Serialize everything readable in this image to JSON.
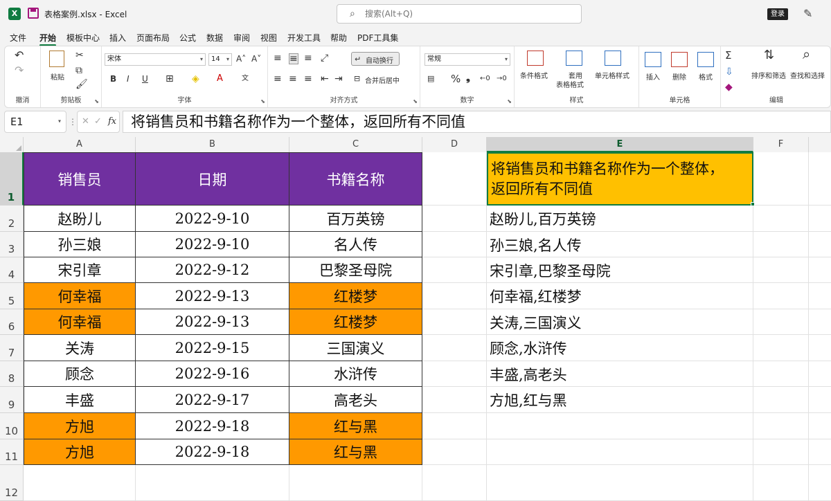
{
  "window": {
    "doc_title": "表格案例.xlsx  -  Excel",
    "search_placeholder": "搜索(Alt+Q)",
    "login_label": "登录",
    "app_logo_letter": "X"
  },
  "menu": {
    "tabs": [
      "文件",
      "开始",
      "模板中心",
      "插入",
      "页面布局",
      "公式",
      "数据",
      "审阅",
      "视图",
      "开发工具",
      "帮助",
      "PDF工具集"
    ],
    "active_index": 1
  },
  "ribbon": {
    "undo_group": "撤消",
    "clipboard_group": "剪贴板",
    "paste_label": "粘贴",
    "font_group": "字体",
    "font_name": "宋体",
    "font_size": "14",
    "bold": "B",
    "italic": "I",
    "underline": "U",
    "align_group": "对齐方式",
    "wrap_text": "自动换行",
    "merge_center": "合并后居中",
    "number_group": "数字",
    "number_format": "常规",
    "percent": "%",
    "comma": "❟",
    "styles_group": "样式",
    "cond_format": "条件格式",
    "table_format_1": "套用",
    "table_format_2": "表格格式",
    "cell_styles": "单元格样式",
    "cells_group": "单元格",
    "insert": "插入",
    "delete": "删除",
    "format": "格式",
    "edit_group": "编辑",
    "sort_filter": "排序和筛选",
    "find_select": "查找和选择"
  },
  "formula_bar": {
    "name_box": "E1",
    "fx": "fx",
    "formula": "将销售员和书籍名称作为一个整体，返回所有不同值"
  },
  "sheet": {
    "columns": [
      "A",
      "B",
      "C",
      "D",
      "E",
      "F"
    ],
    "rows": [
      "1",
      "2",
      "3",
      "4",
      "5",
      "6",
      "7",
      "8",
      "9",
      "10",
      "11",
      "12"
    ],
    "headers": [
      "销售员",
      "日期",
      "书籍名称"
    ],
    "table": [
      {
        "name": "赵盼儿",
        "date": "2022-9-10",
        "book": "百万英镑",
        "dup": false
      },
      {
        "name": "孙三娘",
        "date": "2022-9-10",
        "book": "名人传",
        "dup": false
      },
      {
        "name": "宋引章",
        "date": "2022-9-12",
        "book": "巴黎圣母院",
        "dup": false
      },
      {
        "name": "何幸福",
        "date": "2022-9-13",
        "book": "红楼梦",
        "dup": true
      },
      {
        "name": "何幸福",
        "date": "2022-9-13",
        "book": "红楼梦",
        "dup": true
      },
      {
        "name": "关涛",
        "date": "2022-9-15",
        "book": "三国演义",
        "dup": false
      },
      {
        "name": "顾念",
        "date": "2022-9-16",
        "book": "水浒传",
        "dup": false
      },
      {
        "name": "丰盛",
        "date": "2022-9-17",
        "book": "高老头",
        "dup": false
      },
      {
        "name": "方旭",
        "date": "2022-9-18",
        "book": "红与黑",
        "dup": true
      },
      {
        "name": "方旭",
        "date": "2022-9-18",
        "book": "红与黑",
        "dup": true
      }
    ],
    "e1_line1": "将销售员和书籍名称作为一个整体，",
    "e1_line2": "返回所有不同值",
    "results": [
      "赵盼儿,百万英镑",
      "孙三娘,名人传",
      "宋引章,巴黎圣母院",
      "何幸福,红楼梦",
      "关涛,三国演义",
      "顾念,水浒传",
      "丰盛,高老头",
      "方旭,红与黑"
    ]
  },
  "colors": {
    "accent": "#107c41",
    "header_fill": "#7030a0",
    "dup_fill": "#ff9900",
    "active_fill": "#ffc000"
  }
}
